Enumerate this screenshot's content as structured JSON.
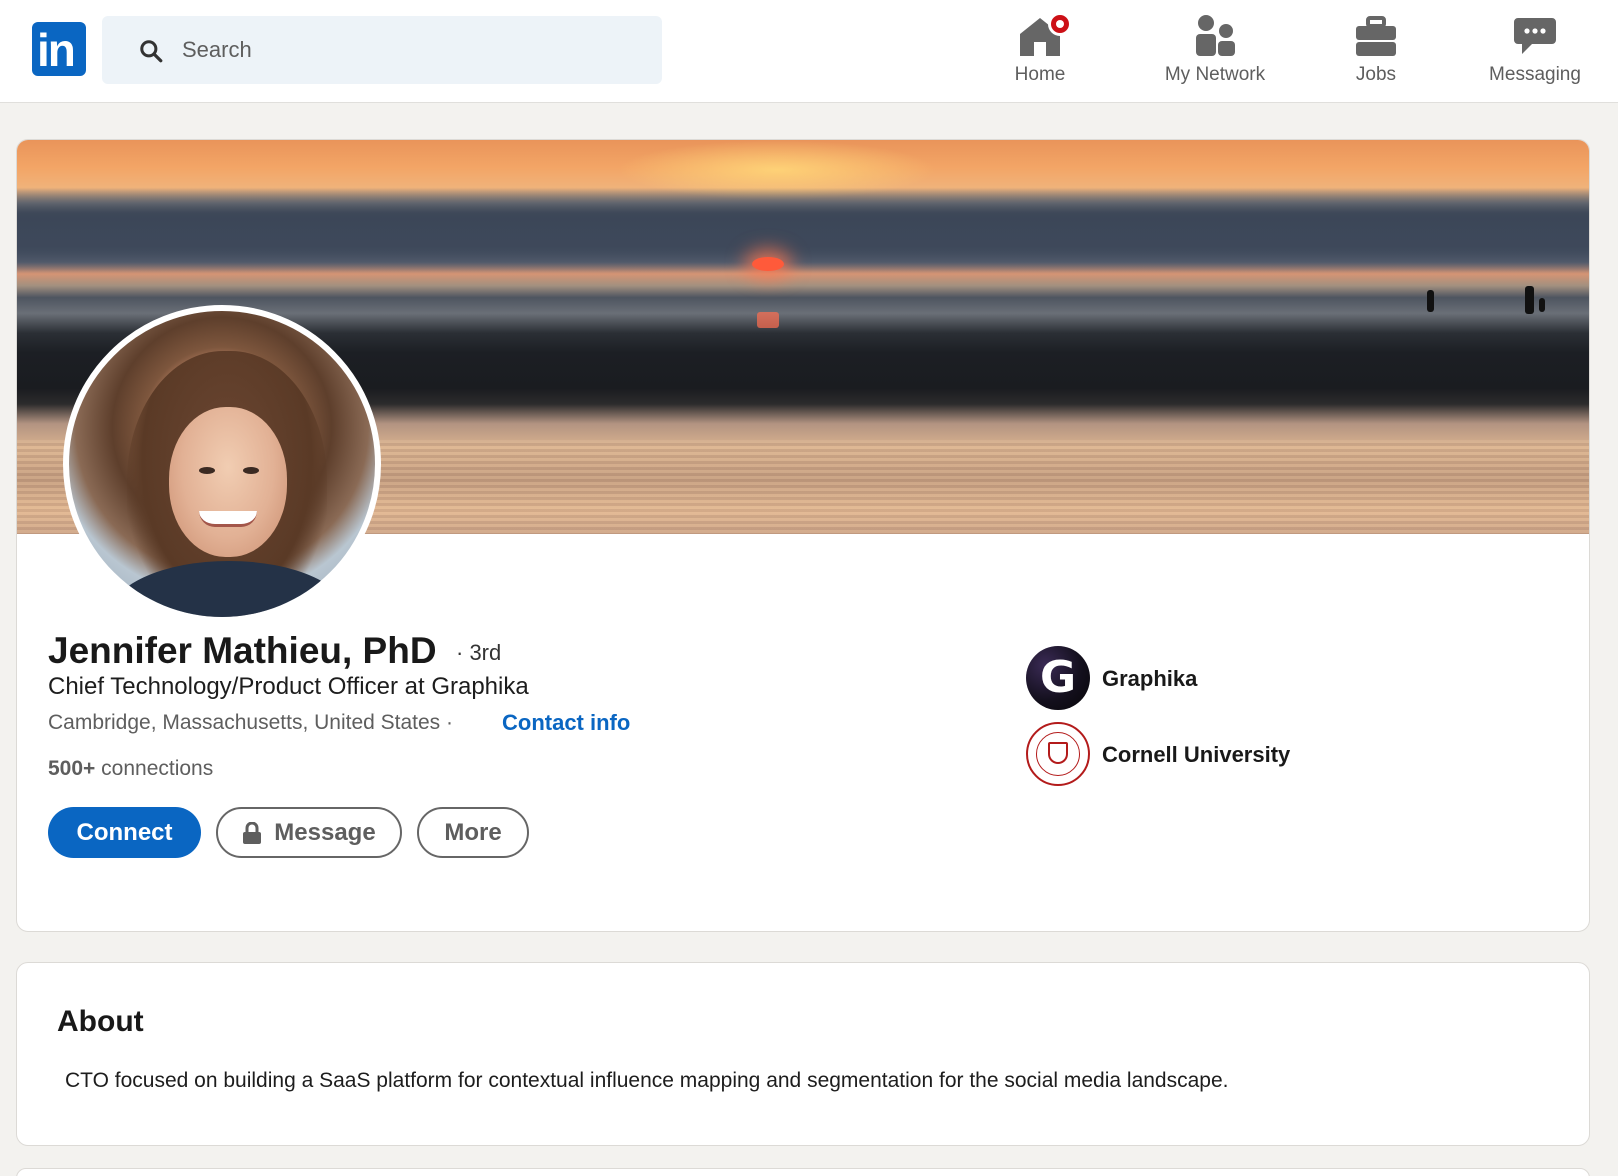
{
  "app": {
    "logo_text": "in"
  },
  "search": {
    "placeholder": "Search"
  },
  "nav": {
    "items": [
      {
        "label": "Home",
        "icon": "home-icon",
        "has_notification": true
      },
      {
        "label": "My Network",
        "icon": "people-icon"
      },
      {
        "label": "Jobs",
        "icon": "briefcase-icon"
      },
      {
        "label": "Messaging",
        "icon": "chat-bubble-icon"
      }
    ]
  },
  "profile": {
    "name": "Jennifer Mathieu, PhD",
    "degree": "· 3rd",
    "headline": "Chief Technology/Product Officer at Graphika",
    "location": "Cambridge, Massachusetts, United States ·",
    "contact_info": "Contact info",
    "connections_count": "500+",
    "connections_label": "connections",
    "actions": {
      "connect": "Connect",
      "message": "Message",
      "more": "More"
    },
    "organizations": [
      {
        "name": "Graphika",
        "logo_letter": "G"
      },
      {
        "name": "Cornell University"
      }
    ]
  },
  "about": {
    "title": "About",
    "text": "CTO focused on building a SaaS platform for contextual influence mapping and segmentation for the social media landscape."
  },
  "colors": {
    "brand": "#0a66c2",
    "notification": "#cc1016",
    "background": "#f3f2ef"
  }
}
